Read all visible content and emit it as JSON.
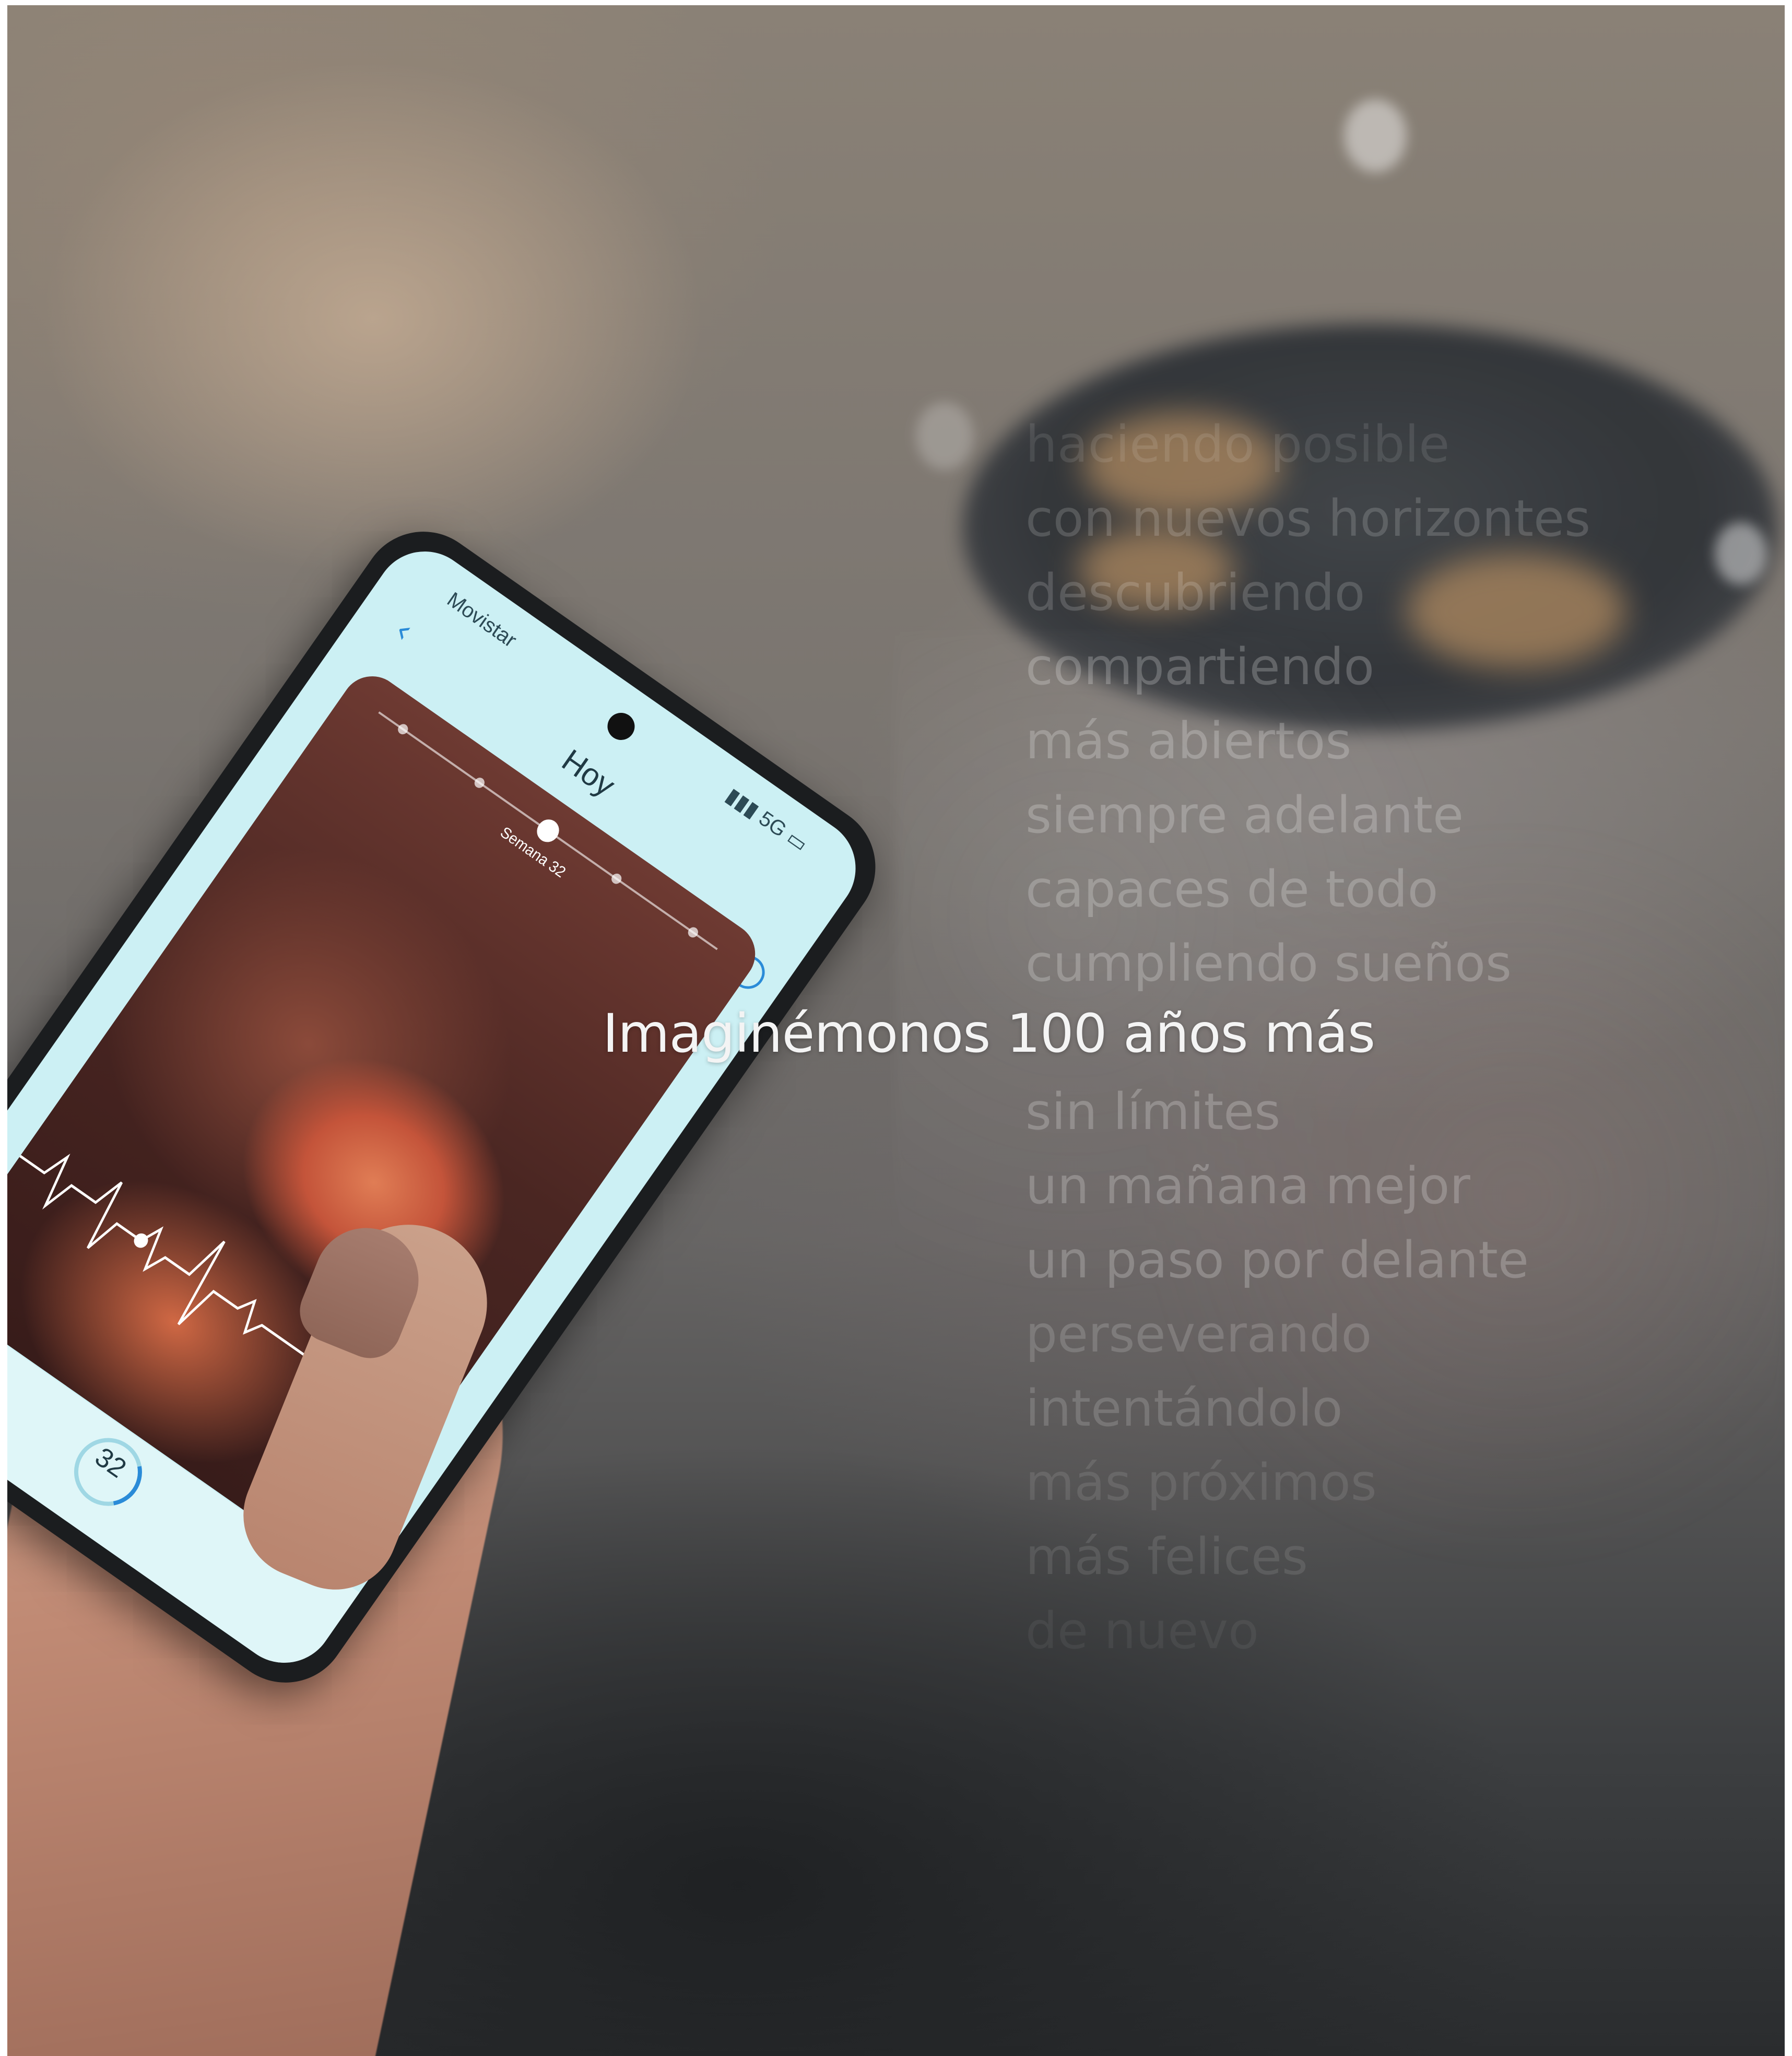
{
  "headline": {
    "prefix": "Imaginémonos",
    "suffix": "100 años más"
  },
  "phrases_above": [
    "haciendo posible",
    "con nuevos horizontes",
    "descubriendo",
    "compartiendo",
    "más abiertos",
    "siempre adelante",
    "capaces de todo",
    "cumpliendo sueños"
  ],
  "phrases_below": [
    "sin límites",
    "un mañana mejor",
    "un paso por delante",
    "perseverando",
    "intentándolo",
    "más próximos",
    "más felices",
    "de nuevo"
  ],
  "phone": {
    "carrier": "Movistar",
    "network": "5G",
    "screen_title": "Hoy",
    "week_label": "Semana 32",
    "metric_value": "32"
  }
}
